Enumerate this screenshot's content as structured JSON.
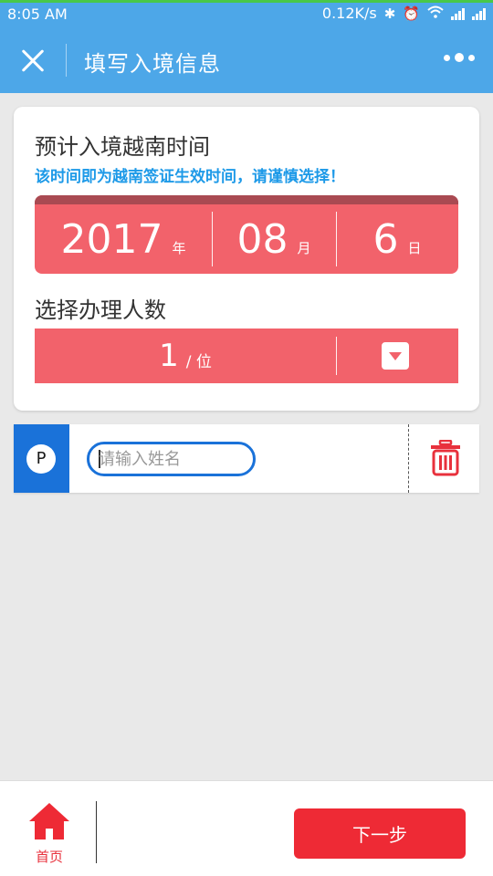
{
  "status_bar": {
    "time": "8:05  AM",
    "net_speed": "0.12K/s"
  },
  "header": {
    "title": "填写入境信息"
  },
  "entry_date": {
    "section_title": "预计入境越南时间",
    "notice": "该时间即为越南签证生效时间，请谨慎选择！",
    "year": "2017",
    "year_unit": "年",
    "month": "08",
    "month_unit": "月",
    "day": "6",
    "day_unit": "日"
  },
  "applicants": {
    "section_title": "选择办理人数",
    "count": "1",
    "count_unit": "/ 位",
    "person_badge": "P",
    "name_placeholder": "请输入姓名",
    "name_value": ""
  },
  "footer": {
    "home_label": "首页",
    "next_label": "下一步"
  },
  "colors": {
    "header_blue": "#4da7e8",
    "accent_red": "#f2626b",
    "notice_blue": "#1e9ae8",
    "badge_blue": "#1a72d9",
    "button_red": "#ee2a35"
  },
  "icons": {
    "close": "close-icon",
    "more": "more-dots-icon",
    "dropdown": "dropdown-arrow-icon",
    "delete": "trash-icon",
    "home": "home-icon"
  }
}
